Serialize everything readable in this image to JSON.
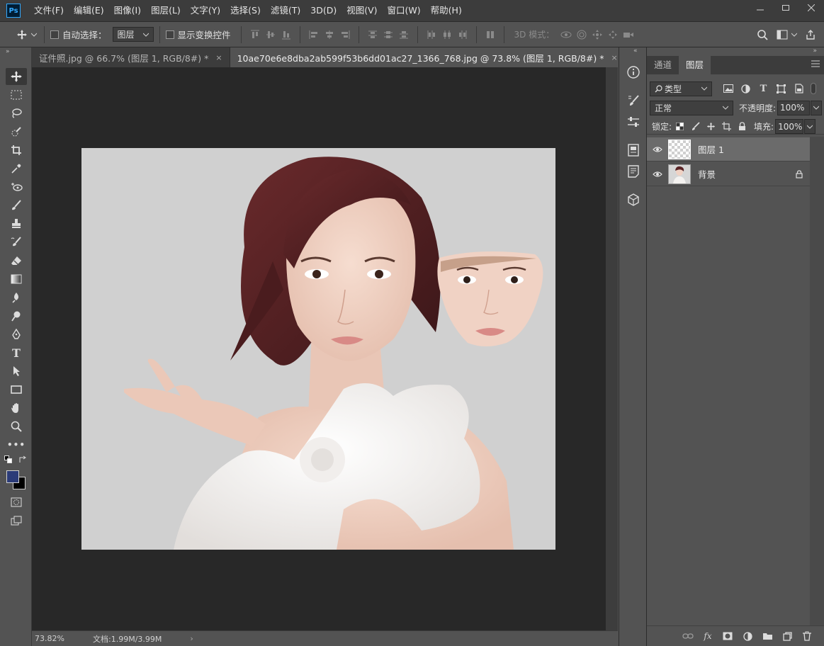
{
  "app": {
    "logo": "Ps"
  },
  "menu": [
    "文件(F)",
    "编辑(E)",
    "图像(I)",
    "图层(L)",
    "文字(Y)",
    "选择(S)",
    "滤镜(T)",
    "3D(D)",
    "视图(V)",
    "窗口(W)",
    "帮助(H)"
  ],
  "options": {
    "auto_select_label": "自动选择：",
    "auto_select_target": "图层",
    "show_transform_label": "显示变换控件",
    "mode_3d_label": "3D 模式："
  },
  "tabs": [
    {
      "label": "证件照.jpg @ 66.7% (图层 1, RGB/8#) *",
      "close": "×"
    },
    {
      "label": "10ae70e6e8dba2ab599f53b6dd01ac27_1366_768.jpg @ 73.8% (图层 1, RGB/8#) *",
      "close": "×"
    }
  ],
  "status": {
    "zoom": "73.82%",
    "doc": "文档:1.99M/3.99M",
    "arrow": "›"
  },
  "panel": {
    "tabs": [
      "通道",
      "图层"
    ],
    "filter_kind": "类型",
    "blend_mode": "正常",
    "opacity_label": "不透明度:",
    "opacity_value": "100%",
    "lock_label": "锁定:",
    "fill_label": "填充:",
    "fill_value": "100%",
    "layers": [
      {
        "name": "图层 1",
        "selected": true
      },
      {
        "name": "背景",
        "locked": true
      }
    ]
  },
  "colors": {
    "foreground": "#2b3b78",
    "background": "#000000",
    "accent": "#31a8ff"
  }
}
